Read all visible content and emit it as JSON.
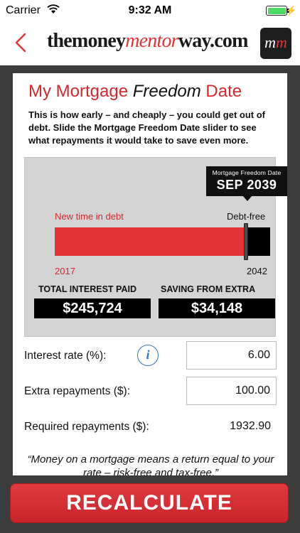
{
  "status_bar": {
    "carrier": "Carrier",
    "time": "9:32 AM",
    "battery_level": 1.0
  },
  "nav": {
    "back_icon": "chevron-left-icon",
    "logo_part1": "themoney",
    "logo_part2": "mentor",
    "logo_part3": "way.com",
    "badge_m1": "m",
    "badge_m2": "m"
  },
  "card": {
    "title_part1": "My Mortgage ",
    "title_part2": "Freedom",
    "title_part3": " Date",
    "intro": "This is how early – and cheaply – you could get out of debt. Slide the Mortgage Freedom Date slider to see what repayments it would take to save even more."
  },
  "timeline": {
    "tooltip_caption": "Mortgage Freedom Date",
    "freedom_date": "SEP 2039",
    "new_time_label": "New time in debt",
    "debt_free_label": "Debt-free",
    "start_year": "2017",
    "end_year": "2042",
    "slider_fraction": 0.888
  },
  "stats": {
    "interest_label": "TOTAL INTEREST PAID",
    "interest_value": "$245,724",
    "saving_label": "SAVING FROM EXTRA",
    "saving_value": "$34,148"
  },
  "form": {
    "interest_label": "Interest rate (%):",
    "interest_value": "6.00",
    "info_icon": "info-icon",
    "extra_label": "Extra repayments ($):",
    "extra_value": "100.00",
    "required_label": "Required repayments ($):",
    "required_value": "1932.90"
  },
  "quote": "“Money on a mortgage means a return equal to your rate – risk-free and tax-free.”",
  "recalculate_label": "RECALCULATE",
  "colors": {
    "accent_red": "#e23438",
    "dark_bg": "#3c3c3c",
    "panel_grey": "#d4d4d4",
    "info_blue": "#3476c8"
  }
}
